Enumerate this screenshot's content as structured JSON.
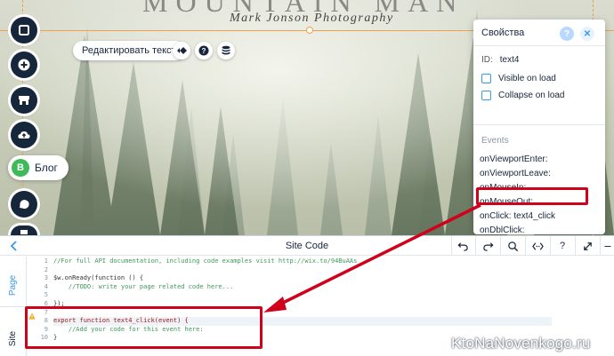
{
  "site": {
    "title_cropped": "MOUNTAIN MAN",
    "subtitle": "Mark Jonson Photography"
  },
  "rail": {
    "blog_badge": "B",
    "blog_label": "Блог"
  },
  "text_toolbar": {
    "edit_text_label": "Редактировать текст",
    "help_glyph": "?"
  },
  "properties": {
    "title": "Свойства",
    "help_glyph": "?",
    "close_glyph": "✕",
    "id_label": "ID:",
    "id_value": "text4",
    "visible_label": "Visible on load",
    "collapse_label": "Collapse on load",
    "events_title": "Events",
    "events": [
      {
        "name": "onViewportEnter:",
        "handler": ""
      },
      {
        "name": "onViewportLeave:",
        "handler": ""
      },
      {
        "name": "onMouseIn:",
        "handler": ""
      },
      {
        "name": "onMouseOut:",
        "handler": ""
      },
      {
        "name": "onClick:",
        "handler": "text4_click"
      },
      {
        "name": "onDblClick:",
        "handler": ""
      }
    ]
  },
  "code_panel": {
    "title": "Site Code",
    "tabs": [
      "Page",
      "Site"
    ],
    "active_tab": "Site",
    "toolbar": {
      "help_glyph": "?"
    },
    "line_numbers": [
      "1",
      "2",
      "3",
      "4",
      "5",
      "6",
      "7",
      "8",
      "9",
      "10"
    ],
    "lines": [
      "//For full API documentation, including code examples visit http://wix.to/94BuAAs",
      "",
      "$w.onReady(function () {",
      "    //TODO: write your page related code here...",
      "",
      "});",
      "",
      "export function text4_click(event) {",
      "    //Add your code for this event here:",
      "}"
    ]
  },
  "watermark": "KtoNaNovenkogo.ru",
  "colors": {
    "rail_button": "#16263b",
    "accent": "#3899ec",
    "highlight": "#d0011b",
    "blog_green": "#3fba58",
    "guide_orange": "#f0a04b"
  }
}
